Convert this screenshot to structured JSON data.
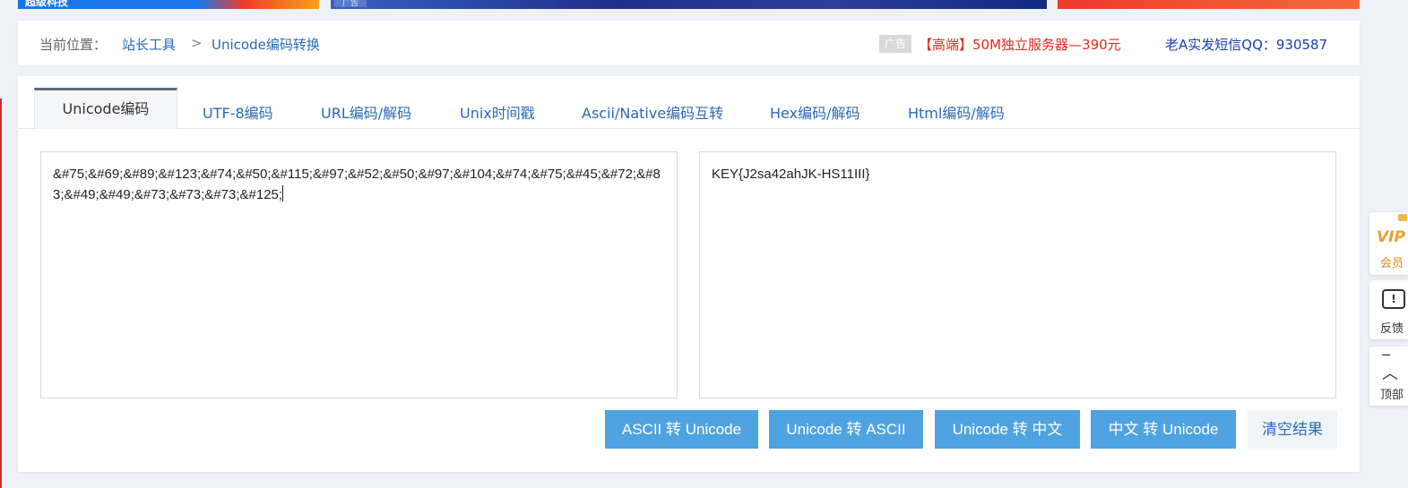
{
  "ads": {
    "banner1_text": "超级科技",
    "banner2_tag": "广告"
  },
  "breadcrumb": {
    "prefix": "当前位置：",
    "item1": "站长工具",
    "separator": ">",
    "item2": "Unicode编码转换"
  },
  "header_ad": {
    "tag": "广告",
    "link": "【高端】50M独立服务器—390元",
    "qq": "老A实发短信QQ：930587"
  },
  "tabs": [
    {
      "label": "Unicode编码"
    },
    {
      "label": "UTF-8编码"
    },
    {
      "label": "URL编码/解码"
    },
    {
      "label": "Unix时间戳"
    },
    {
      "label": "Ascii/Native编码互转"
    },
    {
      "label": "Hex编码/解码"
    },
    {
      "label": "Html编码/解码"
    }
  ],
  "input": {
    "value": "&#75;&#69;&#89;&#123;&#74;&#50;&#115;&#97;&#52;&#50;&#97;&#104;&#74;&#75;&#45;&#72;&#83;&#49;&#49;&#73;&#73;&#73;&#125;"
  },
  "output": {
    "value": "KEY{J2sa42ahJK-HS11III}"
  },
  "buttons": {
    "ascii_to_unicode": "ASCII 转 Unicode",
    "unicode_to_ascii": "Unicode 转 ASCII",
    "unicode_to_chinese": "Unicode 转 中文",
    "chinese_to_unicode": "中文 转 Unicode",
    "clear": "清空结果"
  },
  "sidebar": {
    "vip_mark": "VIP",
    "vip_label": "会员",
    "feedback_label": "反馈",
    "top_label": "顶部"
  },
  "colors": {
    "link_blue": "#2a6bb5",
    "button_blue": "#4fa3e0",
    "ad_red": "#e22a1f"
  }
}
